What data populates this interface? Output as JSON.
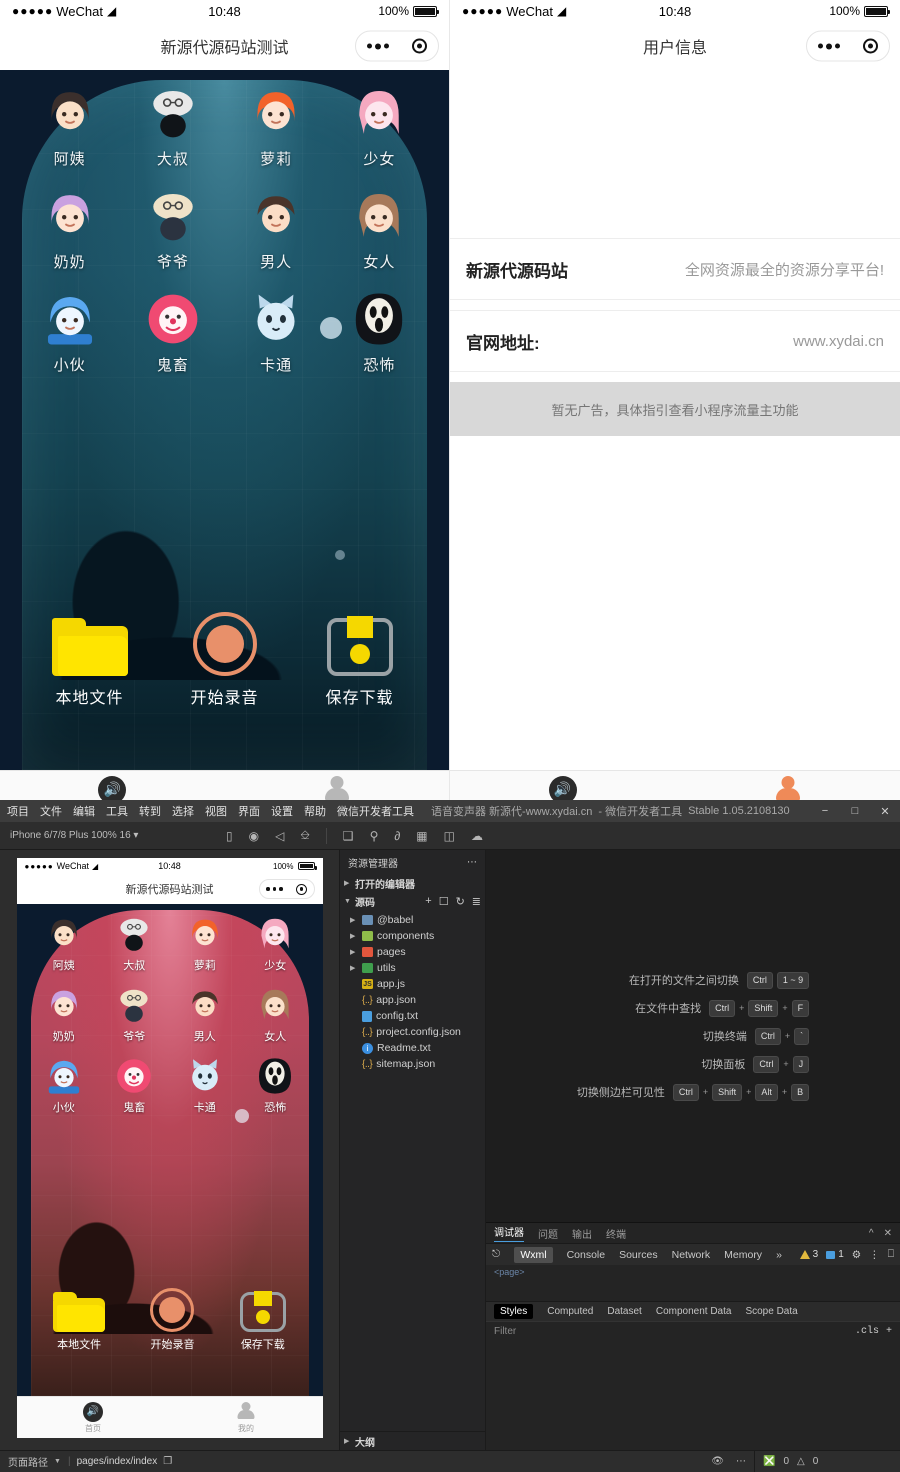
{
  "phone_left": {
    "status": {
      "carrier": "WeChat",
      "dots": "●●●●●",
      "wifi_icon": "wifi-icon",
      "time": "10:48",
      "battery_pct": "100%"
    },
    "nav": {
      "title": "新源代源码站测试",
      "menu_icon": "more-dots-icon",
      "target_icon": "target-circle-icon"
    },
    "avatars": [
      {
        "label": "阿姨",
        "icon": "avatar-auntie"
      },
      {
        "label": "大叔",
        "icon": "avatar-uncle"
      },
      {
        "label": "萝莉",
        "icon": "avatar-loli"
      },
      {
        "label": "少女",
        "icon": "avatar-girl"
      },
      {
        "label": "奶奶",
        "icon": "avatar-grandma"
      },
      {
        "label": "爷爷",
        "icon": "avatar-grandpa"
      },
      {
        "label": "男人",
        "icon": "avatar-man"
      },
      {
        "label": "女人",
        "icon": "avatar-woman"
      },
      {
        "label": "小伙",
        "icon": "avatar-youngman"
      },
      {
        "label": "鬼畜",
        "icon": "avatar-clown"
      },
      {
        "label": "卡通",
        "icon": "avatar-cat"
      },
      {
        "label": "恐怖",
        "icon": "avatar-horror"
      }
    ],
    "actions": [
      {
        "label": "本地文件",
        "icon": "folder-icon"
      },
      {
        "label": "开始录音",
        "icon": "record-button-icon"
      },
      {
        "label": "保存下载",
        "icon": "save-download-icon"
      }
    ],
    "tabbar": [
      {
        "label": "首页",
        "icon": "speaker-icon",
        "active": true
      },
      {
        "label": "我的",
        "icon": "person-icon",
        "active": false
      }
    ]
  },
  "phone_right": {
    "status": {
      "carrier": "WeChat",
      "dots": "●●●●●",
      "wifi_icon": "wifi-icon",
      "time": "10:48",
      "battery_pct": "100%"
    },
    "nav": {
      "title": "用户信息",
      "menu_icon": "more-dots-icon",
      "target_icon": "target-circle-icon"
    },
    "rows": [
      {
        "key": "新源代源码站",
        "value": "全网资源最全的资源分享平台!"
      },
      {
        "key": "官网地址:",
        "value": "www.xydai.cn"
      }
    ],
    "ad_placeholder": "暂无广告，具体指引查看小程序流量主功能",
    "tabbar": [
      {
        "label": "首页",
        "icon": "speaker-icon",
        "active": false
      },
      {
        "label": "我的",
        "icon": "person-icon",
        "active": true
      }
    ]
  },
  "ide": {
    "menu": [
      "项目",
      "文件",
      "编辑",
      "工具",
      "转到",
      "选择",
      "视图",
      "界面",
      "设置",
      "帮助",
      "微信开发者工具"
    ],
    "title_project": "语音变声器 新源代-www.xydai.cn",
    "title_app": "- 微信开发者工具",
    "title_version": "Stable 1.05.2108130",
    "window_controls": {
      "minimize": "−",
      "maximize": "□",
      "close": "✕"
    },
    "toolbar": {
      "device": "iPhone 6/7/8 Plus 100% 16 ▾",
      "icons": [
        "simulator-icon",
        "record-icon",
        "audio-icon",
        "window-icon",
        "copy-icon",
        "search-icon",
        "git-icon",
        "extensions-icon",
        "panel-icon",
        "cloud-icon"
      ]
    },
    "explorer": {
      "title": "资源管理器",
      "more_icon": "more-dots-icon",
      "open_editors": "打开的编辑器",
      "section": "源码",
      "section_tools": [
        "new-file-icon",
        "new-folder-icon",
        "refresh-icon",
        "collapse-icon"
      ],
      "tree": [
        {
          "name": "@babel",
          "type": "folder",
          "color": "#6a90b5"
        },
        {
          "name": "components",
          "type": "folder",
          "color": "#8fbd4a"
        },
        {
          "name": "pages",
          "type": "folder",
          "color": "#e2563d"
        },
        {
          "name": "utils",
          "type": "folder",
          "color": "#3f9e4d"
        },
        {
          "name": "app.js",
          "type": "js"
        },
        {
          "name": "app.json",
          "type": "json"
        },
        {
          "name": "config.txt",
          "type": "txt"
        },
        {
          "name": "project.config.json",
          "type": "json"
        },
        {
          "name": "Readme.txt",
          "type": "info"
        },
        {
          "name": "sitemap.json",
          "type": "json"
        }
      ],
      "outline": "大纲"
    },
    "shortcuts": [
      {
        "label": "在打开的文件之间切换",
        "keys": [
          "Ctrl",
          "1 ~ 9"
        ]
      },
      {
        "label": "在文件中查找",
        "keys": [
          "Ctrl",
          "+",
          "Shift",
          "+",
          "F"
        ]
      },
      {
        "label": "切换终端",
        "keys": [
          "Ctrl",
          "+",
          "`"
        ]
      },
      {
        "label": "切换面板",
        "keys": [
          "Ctrl",
          "+",
          "J"
        ]
      },
      {
        "label": "切换侧边栏可见性",
        "keys": [
          "Ctrl",
          "+",
          "Shift",
          "+",
          "Alt",
          "+",
          "B"
        ]
      }
    ],
    "devtools": {
      "panel_tabs": [
        "调试器",
        "问题",
        "输出",
        "终端"
      ],
      "panel_active": "调试器",
      "collapse_icon": "chevron-up-icon",
      "close_icon": "close-icon",
      "inspect_icon": "inspect-element-icon",
      "tabs": [
        "Wxml",
        "Console",
        "Sources",
        "Network",
        "Memory"
      ],
      "tabs_active": "Wxml",
      "overflow_icon": "chevron-right-icon",
      "warning_count": "3",
      "message_count": "1",
      "settings_icon": "gear-icon",
      "kebab_icon": "more-vertical-icon",
      "dock_icon": "dock-panel-icon",
      "wxml_snippet": "<page>",
      "style_tabs": [
        "Styles",
        "Computed",
        "Dataset",
        "Component Data",
        "Scope Data"
      ],
      "style_active": "Styles",
      "filter_placeholder": "Filter",
      "cls_label": ".cls",
      "add_icon": "plus-icon"
    },
    "status": {
      "path_label": "页面路径",
      "path_value": "pages/index/index",
      "copy_icon": "copy-icon",
      "eye_icon": "eye-icon",
      "more_icon": "more-dots-icon",
      "error_count": "0",
      "warning_count": "0"
    }
  }
}
